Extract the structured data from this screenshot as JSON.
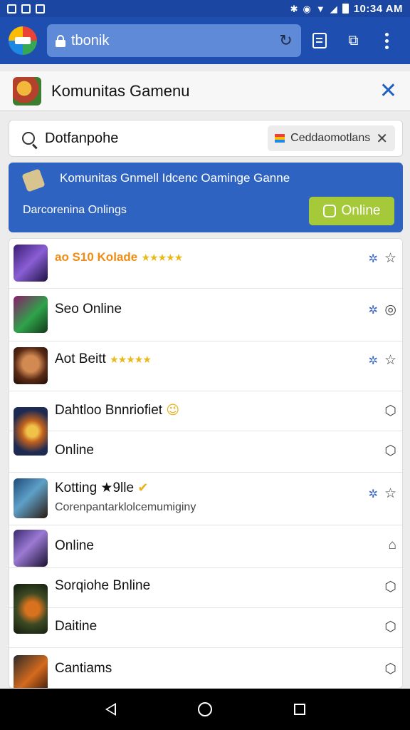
{
  "status_bar": {
    "time": "10:34 AM"
  },
  "browser": {
    "url": "tbonik"
  },
  "app_header": {
    "title": "Komunitas Gamenu"
  },
  "search": {
    "value": "Dotfanpohe",
    "filter_chip": "Ceddaomotlans"
  },
  "banner": {
    "title": "Komunitas Gnmell Idcenc Oamingе Ganne",
    "subtitle": "Darcorenina Onlings",
    "button_label": "Online"
  },
  "games": [
    {
      "label": "ao S10 Kolade",
      "stars": "★★★★★",
      "action": "star"
    },
    {
      "label": "Seo Online",
      "action": "circle"
    },
    {
      "label": "Aot Beitt",
      "stars": "★★★★★",
      "action": "star"
    },
    {
      "label": "Dahtloo Bnnriofiet",
      "badge": "😉",
      "action": "lock"
    },
    {
      "label": "Online",
      "action": "lock"
    },
    {
      "label": "Kotting ★9lle",
      "badge": "✔",
      "sub": "Corenpantarklolcemumiginy",
      "action": "star"
    },
    {
      "label": "Online",
      "action": "home"
    },
    {
      "label": "Sorqiohe Bnline",
      "action": "lock"
    },
    {
      "label": "Daitine",
      "action": "lock"
    },
    {
      "label": "Cantiams",
      "action": "lock"
    }
  ],
  "colors": {
    "primary": "#1e4fb0",
    "banner": "#2f63c1",
    "online_button": "#a6c93a",
    "star_gold": "#e9b81b",
    "accent_blue": "#3a66c6"
  }
}
